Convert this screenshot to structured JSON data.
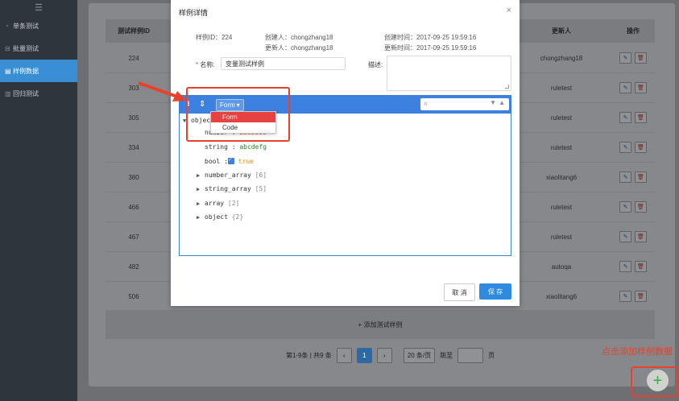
{
  "sidebar": {
    "menu_icon": "☰",
    "items": [
      {
        "label": "单条测试",
        "icon": "gauge-icon"
      },
      {
        "label": "批量测试",
        "icon": "stack-icon"
      },
      {
        "label": "样例数据",
        "icon": "document-icon",
        "active": true
      },
      {
        "label": "回归测试",
        "icon": "list-icon"
      }
    ]
  },
  "table": {
    "headers": {
      "id": "测试样例ID",
      "updater": "更新人",
      "ops": "操作"
    },
    "rows": [
      {
        "id": "224",
        "updater": "chongzhang18"
      },
      {
        "id": "303",
        "updater": "ruletest"
      },
      {
        "id": "305",
        "updater": "ruletest"
      },
      {
        "id": "334",
        "updater": "ruletest"
      },
      {
        "id": "380",
        "updater": "xiaolitang6"
      },
      {
        "id": "466",
        "updater": "ruletest"
      },
      {
        "id": "467",
        "updater": "ruletest"
      },
      {
        "id": "482",
        "updater": "autoqa"
      },
      {
        "id": "506",
        "updater": "xiaolitang6"
      }
    ],
    "add_row": "+ 添加测试样例"
  },
  "pagination": {
    "summary": "第1-9条 | 共9 条",
    "prev": "‹",
    "current": "1",
    "next": "›",
    "page_size": "20 条/页",
    "goto_label": "跳至",
    "page_unit": "页"
  },
  "annotation": {
    "hint": "点击添加样例数据"
  },
  "fab": {
    "icon": "+"
  },
  "modal": {
    "title": "样例详情",
    "close": "×",
    "sample_id": "样例ID：224",
    "creator": "创建人：chongzhang18",
    "updater": "更新人：chongzhang18",
    "created_at": "创建时间：2017-09-25 19:59:16",
    "updated_at": "更新时间：2017-09-25 19:59:16",
    "name_label": "名称:",
    "name_required": "*",
    "name_value": "变量测试样例",
    "desc_label": "描述:",
    "cancel": "取 消",
    "save": "保 存"
  },
  "editor": {
    "mode": "Form",
    "mode_caret": "▾",
    "options": [
      "Form",
      "Code"
    ],
    "tree": {
      "root_key": "object",
      "number_key": "number",
      "number_value": "2333333",
      "string_key": "string",
      "string_value": "abcdefg",
      "bool_key": "bool",
      "bool_value": "true",
      "number_array_key": "number_array",
      "number_array_count": "[6]",
      "string_array_key": "string_array",
      "string_array_count": "[5]",
      "array_key": "array",
      "array_count": "[2]",
      "object_key": "object",
      "object_count": "{2}"
    }
  },
  "colors": {
    "highlight": "#e8412c",
    "primary": "#2f8ae0",
    "editor_bar": "#3c80e0"
  }
}
